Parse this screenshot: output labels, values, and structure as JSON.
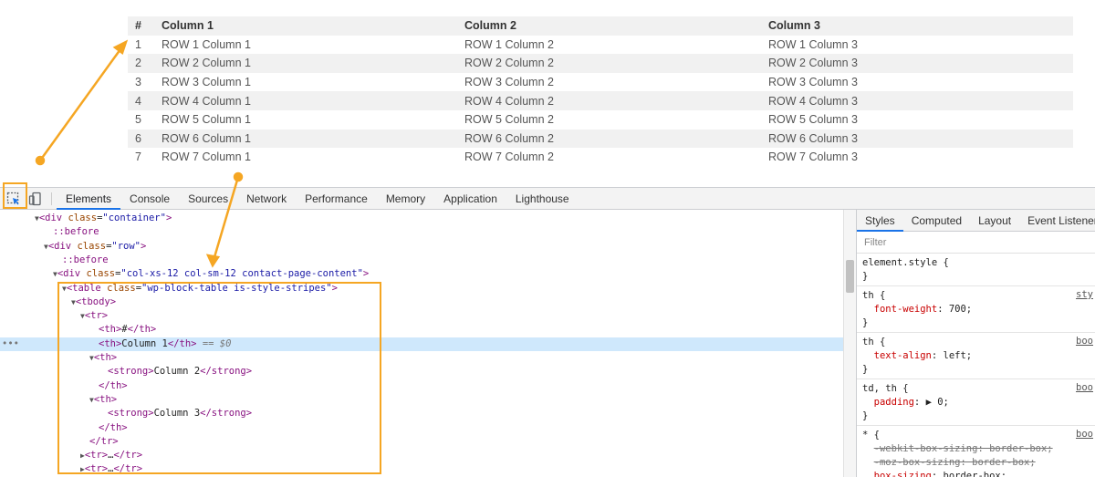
{
  "page_table": {
    "headers": [
      "#",
      "Column 1",
      "Column 2",
      "Column 3"
    ],
    "rows": [
      [
        "1",
        "ROW 1 Column 1",
        "ROW 1 Column 2",
        "ROW 1 Column 3"
      ],
      [
        "2",
        "ROW 2 Column 1",
        "ROW 2 Column 2",
        "ROW 2 Column 3"
      ],
      [
        "3",
        "ROW 3 Column 1",
        "ROW 3 Column 2",
        "ROW 3 Column 3"
      ],
      [
        "4",
        "ROW 4 Column 1",
        "ROW 4 Column 2",
        "ROW 4 Column 3"
      ],
      [
        "5",
        "ROW 5 Column 1",
        "ROW 5 Column 2",
        "ROW 5 Column 3"
      ],
      [
        "6",
        "ROW 6 Column 1",
        "ROW 6 Column 2",
        "ROW 6 Column 3"
      ],
      [
        "7",
        "ROW 7 Column 1",
        "ROW 7 Column 2",
        "ROW 7 Column 3"
      ]
    ]
  },
  "devtools": {
    "tabs": [
      "Elements",
      "Console",
      "Sources",
      "Network",
      "Performance",
      "Memory",
      "Application",
      "Lighthouse"
    ],
    "active_tab": "Elements",
    "dom_lines": [
      {
        "indent": 4,
        "tri": "▼",
        "html": "<span class=\"tag\">&lt;div</span> <span class=\"attr\">class</span>=<span class=\"val\">\"container\"</span><span class=\"tag\">&gt;</span>"
      },
      {
        "indent": 6,
        "tri": "",
        "html": "<span class=\"pseudo\">::before</span>"
      },
      {
        "indent": 5,
        "tri": "▼",
        "html": "<span class=\"tag\">&lt;div</span> <span class=\"attr\">class</span>=<span class=\"val\">\"row\"</span><span class=\"tag\">&gt;</span>"
      },
      {
        "indent": 7,
        "tri": "",
        "html": "<span class=\"pseudo\">::before</span>"
      },
      {
        "indent": 6,
        "tri": "▼",
        "html": "<span class=\"tag\">&lt;div</span> <span class=\"attr\">class</span>=<span class=\"val\">\"col-xs-12 col-sm-12 contact-page-content\"</span><span class=\"tag\">&gt;</span>"
      },
      {
        "indent": 7,
        "tri": "▼",
        "html": "<span class=\"tag\">&lt;table</span> <span class=\"attr\">class</span>=<span class=\"val\">\"wp-block-table is-style-stripes\"</span><span class=\"tag\">&gt;</span>"
      },
      {
        "indent": 8,
        "tri": "▼",
        "html": "<span class=\"tag\">&lt;tbody&gt;</span>"
      },
      {
        "indent": 9,
        "tri": "▼",
        "html": "<span class=\"tag\">&lt;tr&gt;</span>"
      },
      {
        "indent": 11,
        "tri": "",
        "html": "<span class=\"tag\">&lt;th&gt;</span>#<span class=\"tag\">&lt;/th&gt;</span>"
      },
      {
        "indent": 11,
        "tri": "",
        "html": "<span class=\"tag\">&lt;th&gt;</span>Column 1<span class=\"tag\">&lt;/th&gt;</span> <span class=\"eq\">== $0</span>",
        "selected": true
      },
      {
        "indent": 10,
        "tri": "▼",
        "html": "<span class=\"tag\">&lt;th&gt;</span>"
      },
      {
        "indent": 12,
        "tri": "",
        "html": "<span class=\"tag\">&lt;strong&gt;</span>Column 2<span class=\"tag\">&lt;/strong&gt;</span>"
      },
      {
        "indent": 11,
        "tri": "",
        "html": "<span class=\"tag\">&lt;/th&gt;</span>"
      },
      {
        "indent": 10,
        "tri": "▼",
        "html": "<span class=\"tag\">&lt;th&gt;</span>"
      },
      {
        "indent": 12,
        "tri": "",
        "html": "<span class=\"tag\">&lt;strong&gt;</span>Column 3<span class=\"tag\">&lt;/strong&gt;</span>"
      },
      {
        "indent": 11,
        "tri": "",
        "html": "<span class=\"tag\">&lt;/th&gt;</span>"
      },
      {
        "indent": 10,
        "tri": "",
        "html": "<span class=\"tag\">&lt;/tr&gt;</span>"
      },
      {
        "indent": 9,
        "tri": "▶",
        "html": "<span class=\"tag\">&lt;tr&gt;</span>…<span class=\"tag\">&lt;/tr&gt;</span>"
      },
      {
        "indent": 9,
        "tri": "▶",
        "html": "<span class=\"tag\">&lt;tr&gt;</span>…<span class=\"tag\">&lt;/tr&gt;</span>"
      }
    ],
    "selected_marker": "•••",
    "styles_tabs": [
      "Styles",
      "Computed",
      "Layout",
      "Event Listeners"
    ],
    "active_styles_tab": "Styles",
    "filter_placeholder": "Filter",
    "rules": [
      {
        "source": "",
        "lines": [
          "element.style {",
          "}"
        ]
      },
      {
        "source": "sty",
        "lines": [
          "th {",
          "  <span class=\"prop\">font-weight</span>: 700;",
          "}"
        ]
      },
      {
        "source": "boo",
        "lines": [
          "th {",
          "  <span class=\"prop\">text-align</span>: left;",
          "}"
        ]
      },
      {
        "source": "boo",
        "lines": [
          "td, th {",
          "  <span class=\"prop\">padding</span>: ▶ 0;",
          "}"
        ]
      },
      {
        "source": "boo",
        "lines": [
          "* {",
          "  <span class=\"strike\">-webkit-box-sizing: border-box;</span>",
          "  <span class=\"strike\">-moz-box-sizing: border-box;</span>",
          "  <span class=\"prop\">box-sizing</span>: border-box;",
          "}"
        ]
      }
    ]
  },
  "colors": {
    "annotation": "#f5a623",
    "selection": "#cfe8fc",
    "active_tab": "#1a73e8"
  }
}
